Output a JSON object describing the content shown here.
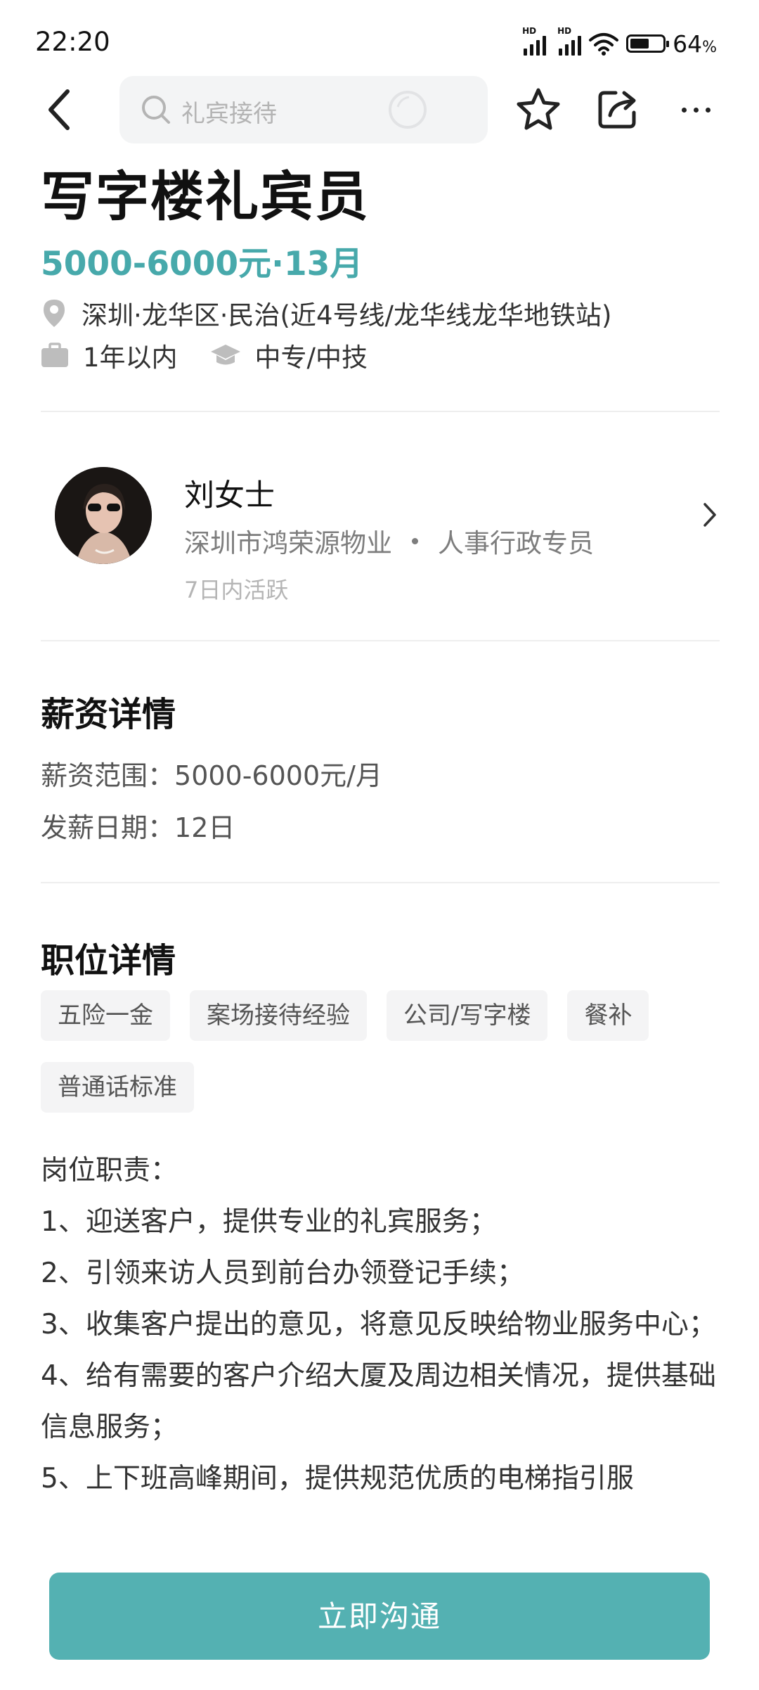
{
  "status_bar": {
    "time": "22:20",
    "signal1_label": "HD",
    "signal2_label": "HD",
    "battery_percent": 64,
    "battery_text": "64",
    "battery_unit": "%"
  },
  "nav": {
    "search_placeholder": "礼宾接待"
  },
  "job": {
    "title": "写字楼礼宾员",
    "salary": "5000-6000元·13月",
    "location": "深圳·龙华区·民治(近4号线/龙华线龙华地铁站)",
    "experience": "1年以内",
    "education": "中专/中技"
  },
  "recruiter": {
    "name": "刘女士",
    "company": "深圳市鸿荣源物业",
    "role": "人事行政专员",
    "active": "7日内活跃"
  },
  "salary_section": {
    "title": "薪资详情",
    "range_label": "薪资范围：",
    "range_value": "5000-6000元/月",
    "payday_label": "发薪日期：",
    "payday_value": "12日"
  },
  "job_section": {
    "title": "职位详情",
    "tags": [
      "五险一金",
      "案场接待经验",
      "公司/写字楼",
      "餐补",
      "普通话标准"
    ],
    "description": [
      "岗位职责：",
      "1、迎送客户，提供专业的礼宾服务；",
      "2、引领来访人员到前台办领登记手续；",
      "3、收集客户提出的意见，将意见反映给物业服务中心；",
      "4、给有需要的客户介绍大厦及周边相关情况，提供基础信息服务；",
      "5、上下班高峰期间，提供规范优质的电梯指引服"
    ]
  },
  "cta": {
    "label": "立即沟通"
  },
  "colors": {
    "accent": "#47a9ab",
    "button": "#54b1b2"
  }
}
